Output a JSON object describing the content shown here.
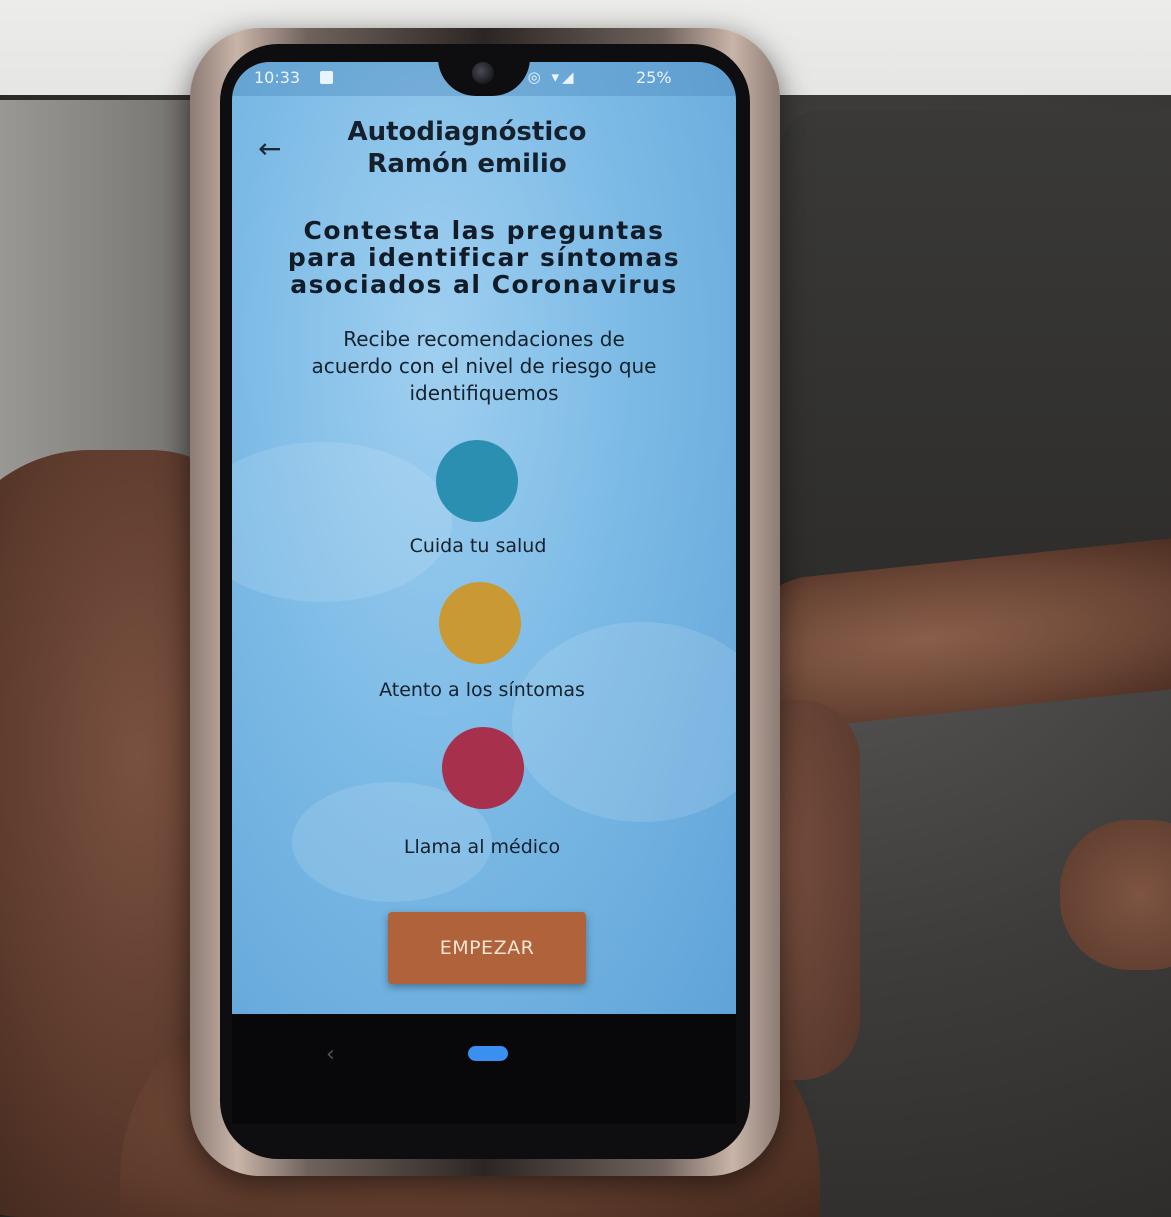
{
  "status_bar": {
    "time": "10:33",
    "icons": "• ◎ ▾◢",
    "battery": "25%"
  },
  "header": {
    "back_glyph": "←",
    "title_line1": "Autodiagnóstico",
    "title_line2": "Ramón emilio"
  },
  "intro": {
    "heading_line1": "Contesta las preguntas",
    "heading_line2": "para identificar síntomas",
    "heading_line3": "asociados al Coronavirus",
    "sub_line1": "Recibe recomendaciones de",
    "sub_line2": "acuerdo con el nivel de riesgo que",
    "sub_line3": "identifiquemos"
  },
  "risk_levels": [
    {
      "label": "Cuida tu salud",
      "color": "#2b8fb2"
    },
    {
      "label": "Atento a los síntomas",
      "color": "#c99a34"
    },
    {
      "label": "Llama al médico",
      "color": "#a7304c"
    }
  ],
  "start_button": {
    "label": "EMPEZAR",
    "color": "#b0633a"
  },
  "nav": {
    "back_glyph": "‹",
    "home_color": "#3a8ff0"
  }
}
